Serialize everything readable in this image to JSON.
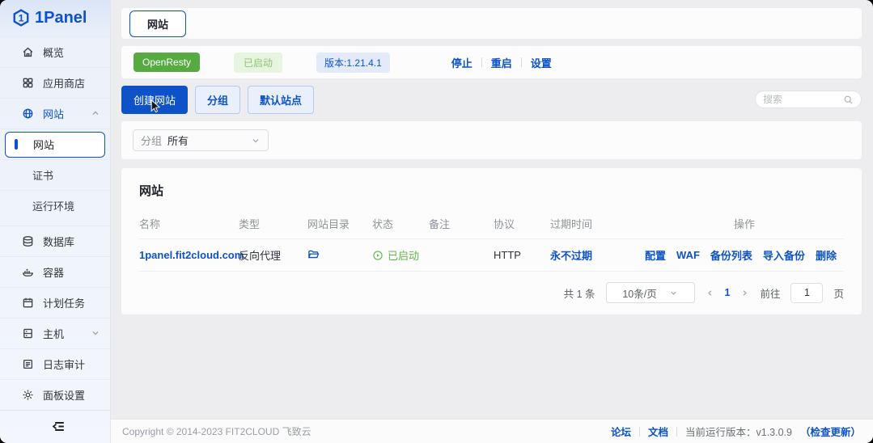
{
  "colors": {
    "primary": "#0d53c7",
    "success_solid": "#55ab40",
    "success_text": "#67b54a",
    "page_bg": "#ededef",
    "card_bg": "#fcfcfd"
  },
  "sidebar": {
    "logo": "1Panel",
    "overview": "概览",
    "appstore": "应用商店",
    "website": "网站",
    "website_sub": "网站",
    "cert": "证书",
    "runtime": "运行环境",
    "database": "数据库",
    "container": "容器",
    "cronjob": "计划任务",
    "host": "主机",
    "logs": "日志审计",
    "settings": "面板设置"
  },
  "header": {
    "tab": "网站"
  },
  "service": {
    "name": "OpenResty",
    "status": "已启动",
    "version": "版本:1.21.4.1",
    "stop": "停止",
    "restart": "重启",
    "setting": "设置"
  },
  "toolbar": {
    "create": "创建网站",
    "group": "分组",
    "default_site": "默认站点",
    "search_placeholder": "搜索"
  },
  "filter": {
    "label": "分组",
    "value": "所有"
  },
  "table": {
    "title": "网站",
    "columns": [
      "名称",
      "类型",
      "网站目录",
      "状态",
      "备注",
      "协议",
      "过期时间",
      "操作"
    ],
    "rows": [
      {
        "name": "1panel.fit2cloud.com",
        "type": "反向代理",
        "status": "已启动",
        "remark": "",
        "protocol": "HTTP",
        "expire": "永不过期",
        "actions": [
          "配置",
          "WAF",
          "备份列表",
          "导入备份",
          "删除"
        ]
      }
    ]
  },
  "pagination": {
    "total": "共 1 条",
    "page_size": "10条/页",
    "page": "1",
    "goto": "前往",
    "goto_value": "1",
    "unit": "页"
  },
  "footer": {
    "copyright": "Copyright © 2014-2023 FIT2CLOUD 飞致云",
    "forum": "论坛",
    "docs": "文档",
    "version": "当前运行版本：v1.3.0.9",
    "check_update": "（检查更新）"
  }
}
